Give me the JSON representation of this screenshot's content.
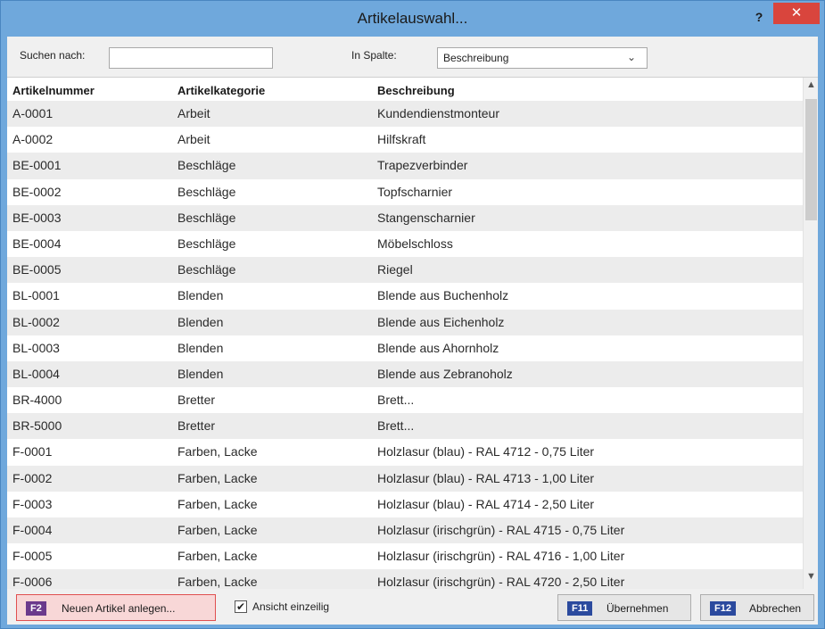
{
  "window": {
    "title": "Artikelauswahl...",
    "help_label": "?",
    "close_label": "✕"
  },
  "search": {
    "label": "Suchen nach:",
    "value": "",
    "column_label": "In Spalte:",
    "column_value": "Beschreibung"
  },
  "table": {
    "columns": [
      "Artikelnummer",
      "Artikelkategorie",
      "Beschreibung"
    ],
    "rows": [
      [
        "A-0001",
        "Arbeit",
        "Kundendienstmonteur"
      ],
      [
        "A-0002",
        "Arbeit",
        "Hilfskraft"
      ],
      [
        "BE-0001",
        "Beschläge",
        "Trapezverbinder"
      ],
      [
        "BE-0002",
        "Beschläge",
        "Topfscharnier"
      ],
      [
        "BE-0003",
        "Beschläge",
        "Stangenscharnier"
      ],
      [
        "BE-0004",
        "Beschläge",
        "Möbelschloss"
      ],
      [
        "BE-0005",
        "Beschläge",
        "Riegel"
      ],
      [
        "BL-0001",
        "Blenden",
        "Blende aus Buchenholz"
      ],
      [
        "BL-0002",
        "Blenden",
        "Blende aus Eichenholz"
      ],
      [
        "BL-0003",
        "Blenden",
        "Blende aus Ahornholz"
      ],
      [
        "BL-0004",
        "Blenden",
        "Blende aus Zebranoholz"
      ],
      [
        "BR-4000",
        "Bretter",
        "Brett..."
      ],
      [
        "BR-5000",
        "Bretter",
        "Brett..."
      ],
      [
        "F-0001",
        "Farben, Lacke",
        "Holzlasur (blau) - RAL 4712 - 0,75 Liter"
      ],
      [
        "F-0002",
        "Farben, Lacke",
        "Holzlasur (blau) - RAL 4713 - 1,00 Liter"
      ],
      [
        "F-0003",
        "Farben, Lacke",
        "Holzlasur (blau) - RAL 4714 - 2,50 Liter"
      ],
      [
        "F-0004",
        "Farben, Lacke",
        "Holzlasur (irischgrün) - RAL 4715 - 0,75 Liter"
      ],
      [
        "F-0005",
        "Farben, Lacke",
        "Holzlasur (irischgrün) - RAL 4716 - 1,00 Liter"
      ],
      [
        "F-0006",
        "Farben, Lacke",
        "Holzlasur (irischgrün) - RAL 4720 - 2,50 Liter"
      ]
    ]
  },
  "footer": {
    "new_key": "F2",
    "new_label": "Neuen Artikel anlegen...",
    "single_line_label": "Ansicht einzeilig",
    "single_line_checked": true,
    "ok_key": "F11",
    "ok_label": "Übernehmen",
    "cancel_key": "F12",
    "cancel_label": "Abbrechen"
  },
  "colors": {
    "title_bar": "#6fa8dc",
    "close_button": "#d9453d",
    "key_badge": "#2b4a9e",
    "new_key_badge": "#6b3a8c",
    "new_button_border": "#e05050"
  },
  "icons": {
    "close": "close-icon",
    "dropdown": "chevron-down-icon",
    "scroll_up": "chevron-up-icon",
    "scroll_down": "chevron-down-icon",
    "checkbox": "checkmark-icon"
  }
}
